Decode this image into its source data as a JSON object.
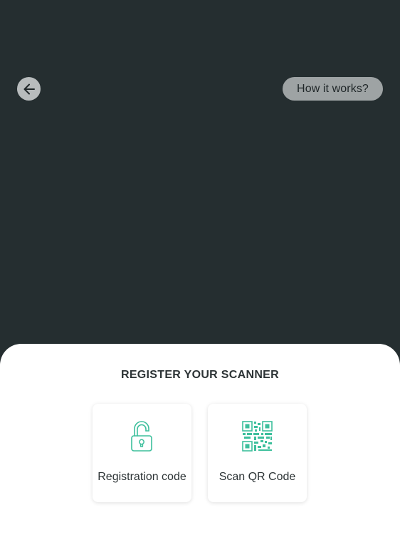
{
  "header": {
    "back_icon": "arrow-left-icon",
    "how_it_works_label": "How it works?"
  },
  "sheet": {
    "title": "REGISTER YOUR SCANNER",
    "options": [
      {
        "label": "Registration code",
        "icon": "unlocked-padlock-icon"
      },
      {
        "label": "Scan QR Code",
        "icon": "qr-code-icon"
      }
    ]
  },
  "colors": {
    "background": "#252e30",
    "accent": "#3dbf9c",
    "sheet": "#ffffff",
    "text": "#2c3335"
  }
}
